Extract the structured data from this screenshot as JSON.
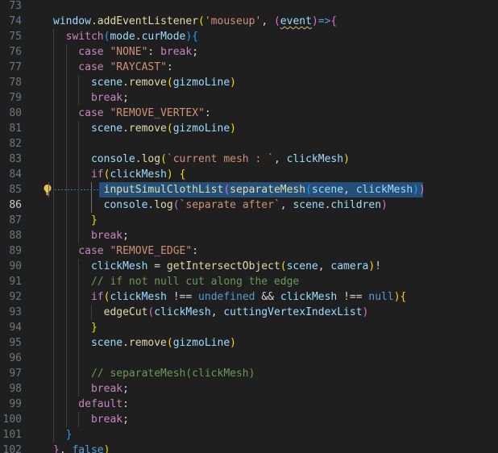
{
  "editor": {
    "active_line": 86,
    "lines": [
      {
        "num": "73",
        "tokens": []
      },
      {
        "num": "74",
        "tokens": [
          {
            "t": "v",
            "x": "window"
          },
          {
            "t": "t",
            "x": "."
          },
          {
            "t": "f",
            "x": "addEventListener"
          },
          {
            "t": "b1",
            "x": "("
          },
          {
            "t": "s",
            "x": "'mouseup'"
          },
          {
            "t": "t",
            "x": ", "
          },
          {
            "t": "b2",
            "x": "("
          },
          {
            "t": "v squig",
            "x": "event"
          },
          {
            "t": "b2",
            "x": ")"
          },
          {
            "t": "kw",
            "x": "=>"
          },
          {
            "t": "b2",
            "x": "{"
          }
        ]
      },
      {
        "num": "75",
        "tokens": [
          {
            "t": "k",
            "x": "  switch"
          },
          {
            "t": "b3",
            "x": "("
          },
          {
            "t": "v",
            "x": "mode"
          },
          {
            "t": "t",
            "x": "."
          },
          {
            "t": "v",
            "x": "curMode"
          },
          {
            "t": "b3",
            "x": ")"
          },
          {
            "t": "b3",
            "x": "{"
          }
        ]
      },
      {
        "num": "76",
        "tokens": [
          {
            "t": "k",
            "x": "    case "
          },
          {
            "t": "s",
            "x": "\"NONE\""
          },
          {
            "t": "t",
            "x": ": "
          },
          {
            "t": "k",
            "x": "break"
          },
          {
            "t": "t",
            "x": ";"
          }
        ]
      },
      {
        "num": "77",
        "tokens": [
          {
            "t": "k",
            "x": "    case "
          },
          {
            "t": "s",
            "x": "\"RAYCAST\""
          },
          {
            "t": "t",
            "x": ":"
          }
        ]
      },
      {
        "num": "78",
        "tokens": [
          {
            "t": "v",
            "x": "      scene"
          },
          {
            "t": "t",
            "x": "."
          },
          {
            "t": "f",
            "x": "remove"
          },
          {
            "t": "b1",
            "x": "("
          },
          {
            "t": "v",
            "x": "gizmoLine"
          },
          {
            "t": "b1",
            "x": ")"
          }
        ]
      },
      {
        "num": "79",
        "tokens": [
          {
            "t": "k",
            "x": "      break"
          },
          {
            "t": "t",
            "x": ";"
          }
        ]
      },
      {
        "num": "80",
        "tokens": [
          {
            "t": "k",
            "x": "    case "
          },
          {
            "t": "s",
            "x": "\"REMOVE_VERTEX\""
          },
          {
            "t": "t",
            "x": ":"
          }
        ]
      },
      {
        "num": "81",
        "tokens": [
          {
            "t": "v",
            "x": "      scene"
          },
          {
            "t": "t",
            "x": "."
          },
          {
            "t": "f",
            "x": "remove"
          },
          {
            "t": "b1",
            "x": "("
          },
          {
            "t": "v",
            "x": "gizmoLine"
          },
          {
            "t": "b1",
            "x": ")"
          }
        ]
      },
      {
        "num": "82",
        "tokens": []
      },
      {
        "num": "83",
        "tokens": [
          {
            "t": "v",
            "x": "      console"
          },
          {
            "t": "t",
            "x": "."
          },
          {
            "t": "f",
            "x": "log"
          },
          {
            "t": "b1",
            "x": "("
          },
          {
            "t": "s",
            "x": "`current mesh : `"
          },
          {
            "t": "t",
            "x": ", "
          },
          {
            "t": "v",
            "x": "clickMesh"
          },
          {
            "t": "b1",
            "x": ")"
          }
        ]
      },
      {
        "num": "84",
        "tokens": [
          {
            "t": "k",
            "x": "      if"
          },
          {
            "t": "b1",
            "x": "("
          },
          {
            "t": "v",
            "x": "clickMesh"
          },
          {
            "t": "b1",
            "x": ")"
          },
          {
            "t": "t",
            "x": " "
          },
          {
            "t": "b1",
            "x": "{"
          }
        ]
      },
      {
        "num": "85",
        "highlight": true,
        "tokens": [
          {
            "t": "f",
            "x": "        inputSimulClothList"
          },
          {
            "t": "b2",
            "x": "("
          },
          {
            "t": "f",
            "x": "separateMesh"
          },
          {
            "t": "b3",
            "x": "("
          },
          {
            "t": "v",
            "x": "scene"
          },
          {
            "t": "t",
            "x": ", "
          },
          {
            "t": "v",
            "x": "clickMesh"
          },
          {
            "t": "b3",
            "x": ")"
          },
          {
            "t": "b2",
            "x": ")"
          }
        ]
      },
      {
        "num": "86",
        "tokens": [
          {
            "t": "v",
            "x": "        console"
          },
          {
            "t": "t",
            "x": "."
          },
          {
            "t": "f",
            "x": "log"
          },
          {
            "t": "b2",
            "x": "("
          },
          {
            "t": "s",
            "x": "`separate after`"
          },
          {
            "t": "t",
            "x": ", "
          },
          {
            "t": "v",
            "x": "scene"
          },
          {
            "t": "t",
            "x": "."
          },
          {
            "t": "v",
            "x": "children"
          },
          {
            "t": "b2",
            "x": ")"
          }
        ]
      },
      {
        "num": "87",
        "tokens": [
          {
            "t": "b1",
            "x": "      }"
          }
        ]
      },
      {
        "num": "88",
        "tokens": [
          {
            "t": "k",
            "x": "      break"
          },
          {
            "t": "t",
            "x": ";"
          }
        ]
      },
      {
        "num": "89",
        "tokens": [
          {
            "t": "k",
            "x": "    case "
          },
          {
            "t": "s",
            "x": "\"REMOVE_EDGE\""
          },
          {
            "t": "t",
            "x": ":"
          }
        ]
      },
      {
        "num": "90",
        "tokens": [
          {
            "t": "v",
            "x": "      clickMesh"
          },
          {
            "t": "t",
            "x": " = "
          },
          {
            "t": "f",
            "x": "getIntersectObject"
          },
          {
            "t": "b1",
            "x": "("
          },
          {
            "t": "v",
            "x": "scene"
          },
          {
            "t": "t",
            "x": ", "
          },
          {
            "t": "v",
            "x": "camera"
          },
          {
            "t": "b1",
            "x": ")"
          },
          {
            "t": "t",
            "x": "!"
          }
        ]
      },
      {
        "num": "91",
        "tokens": [
          {
            "t": "c",
            "x": "      // if not null cut along the edge"
          }
        ]
      },
      {
        "num": "92",
        "tokens": [
          {
            "t": "k",
            "x": "      if"
          },
          {
            "t": "b1",
            "x": "("
          },
          {
            "t": "v",
            "x": "clickMesh"
          },
          {
            "t": "t",
            "x": " !== "
          },
          {
            "t": "kw",
            "x": "undefined"
          },
          {
            "t": "t",
            "x": " && "
          },
          {
            "t": "v",
            "x": "clickMesh"
          },
          {
            "t": "t",
            "x": " !== "
          },
          {
            "t": "kw",
            "x": "null"
          },
          {
            "t": "b1",
            "x": ")"
          },
          {
            "t": "b1",
            "x": "{"
          }
        ]
      },
      {
        "num": "93",
        "tokens": [
          {
            "t": "f",
            "x": "        edgeCut"
          },
          {
            "t": "b2",
            "x": "("
          },
          {
            "t": "v",
            "x": "clickMesh"
          },
          {
            "t": "t",
            "x": ", "
          },
          {
            "t": "v",
            "x": "cuttingVertexIndexList"
          },
          {
            "t": "b2",
            "x": ")"
          }
        ]
      },
      {
        "num": "94",
        "tokens": [
          {
            "t": "b1",
            "x": "      }"
          }
        ]
      },
      {
        "num": "95",
        "tokens": [
          {
            "t": "v",
            "x": "      scene"
          },
          {
            "t": "t",
            "x": "."
          },
          {
            "t": "f",
            "x": "remove"
          },
          {
            "t": "b1",
            "x": "("
          },
          {
            "t": "v",
            "x": "gizmoLine"
          },
          {
            "t": "b1",
            "x": ")"
          }
        ]
      },
      {
        "num": "96",
        "tokens": []
      },
      {
        "num": "97",
        "tokens": [
          {
            "t": "c",
            "x": "      // separateMesh(clickMesh)"
          }
        ]
      },
      {
        "num": "98",
        "tokens": [
          {
            "t": "k",
            "x": "      break"
          },
          {
            "t": "t",
            "x": ";"
          }
        ]
      },
      {
        "num": "99",
        "tokens": [
          {
            "t": "k",
            "x": "    default"
          },
          {
            "t": "t",
            "x": ":"
          }
        ]
      },
      {
        "num": "100",
        "tokens": [
          {
            "t": "k",
            "x": "      break"
          },
          {
            "t": "t",
            "x": ";"
          }
        ]
      },
      {
        "num": "101",
        "tokens": [
          {
            "t": "b3",
            "x": "  }"
          }
        ]
      },
      {
        "num": "102",
        "tokens": [
          {
            "t": "b2",
            "x": "}"
          },
          {
            "t": "t",
            "x": ", "
          },
          {
            "t": "kw",
            "x": "false"
          },
          {
            "t": "b1",
            "x": ")"
          }
        ]
      }
    ]
  },
  "icons": {
    "lightbulb": "lightbulb-icon"
  }
}
